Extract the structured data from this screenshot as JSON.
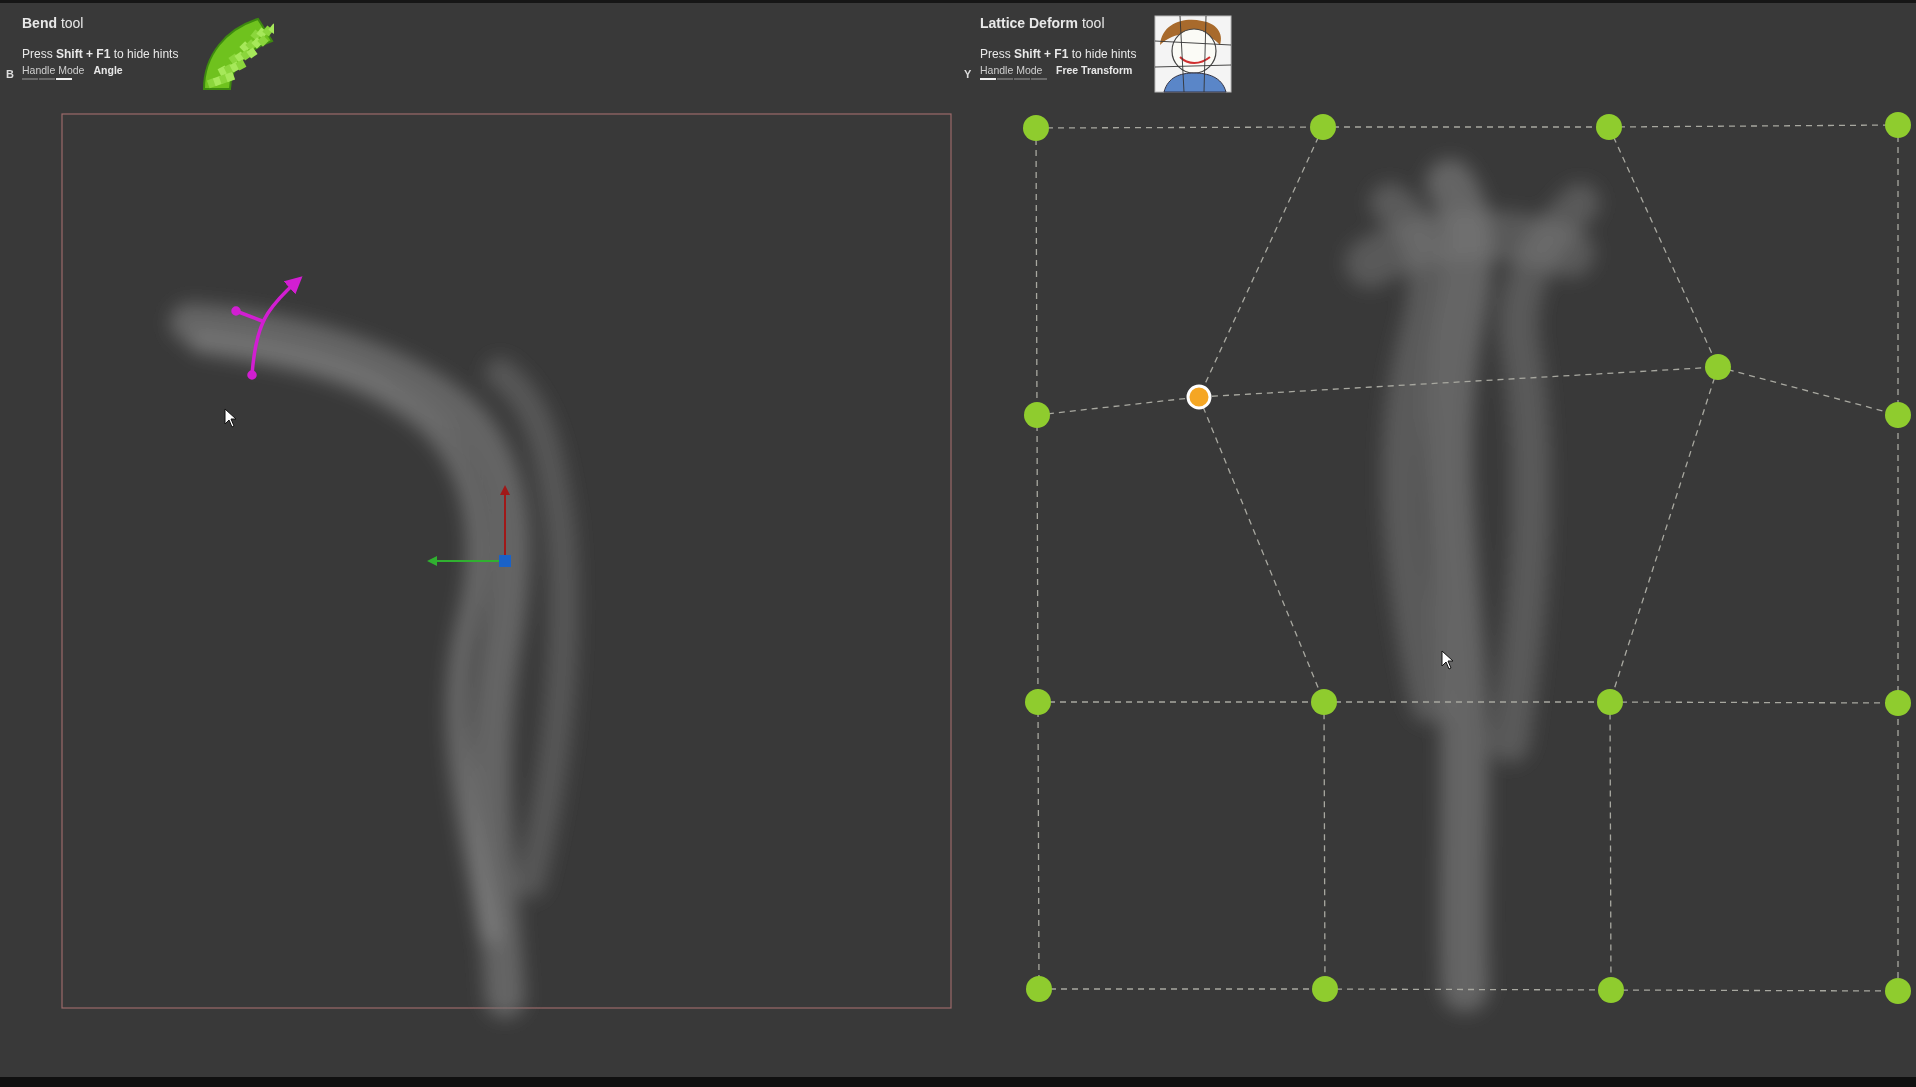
{
  "panels": [
    {
      "kind": "bend",
      "shortcut_key": "B",
      "tool_name": "Bend",
      "tool_suffix": "tool",
      "hint": "Press **Shift + F1** to hide hints",
      "mode_label": "Handle Mode",
      "mode_value": "Angle",
      "mode_segments": [
        {
          "selected": false
        },
        {
          "selected": false
        },
        {
          "selected": true
        }
      ]
    },
    {
      "kind": "lattice",
      "shortcut_key": "Y",
      "tool_name": "Lattice Deform",
      "tool_suffix": "tool",
      "hint": "Press **Shift + F1** to hide hints",
      "mode_label": "Handle Mode",
      "mode_value": "Free Transform",
      "mode_segments": [
        {
          "selected": true
        },
        {
          "selected": false
        },
        {
          "selected": false
        },
        {
          "selected": false
        }
      ]
    }
  ],
  "lattice_points": [
    {
      "selected": false
    },
    {
      "selected": false
    },
    {
      "selected": false
    },
    {
      "selected": false
    },
    {
      "selected": false
    },
    {
      "selected": true
    },
    {
      "selected": false
    },
    {
      "selected": false
    },
    {
      "selected": false
    },
    {
      "selected": false
    },
    {
      "selected": false
    },
    {
      "selected": false
    },
    {
      "selected": false
    },
    {
      "selected": false
    },
    {
      "selected": false
    },
    {
      "selected": false
    }
  ]
}
